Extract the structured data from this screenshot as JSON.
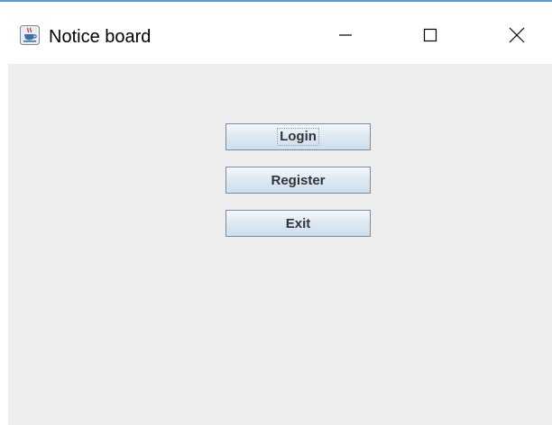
{
  "window": {
    "title": "Notice board",
    "icon": "java-cup-icon",
    "controls": [
      "minimize-icon",
      "maximize-icon",
      "close-icon"
    ]
  },
  "buttons": {
    "login": "Login",
    "register": "Register",
    "exit": "Exit"
  },
  "colors": {
    "title_border": "#5b9bd5",
    "content_background": "#eeeeee",
    "button_border": "#7a8a99",
    "button_text": "#333333"
  }
}
